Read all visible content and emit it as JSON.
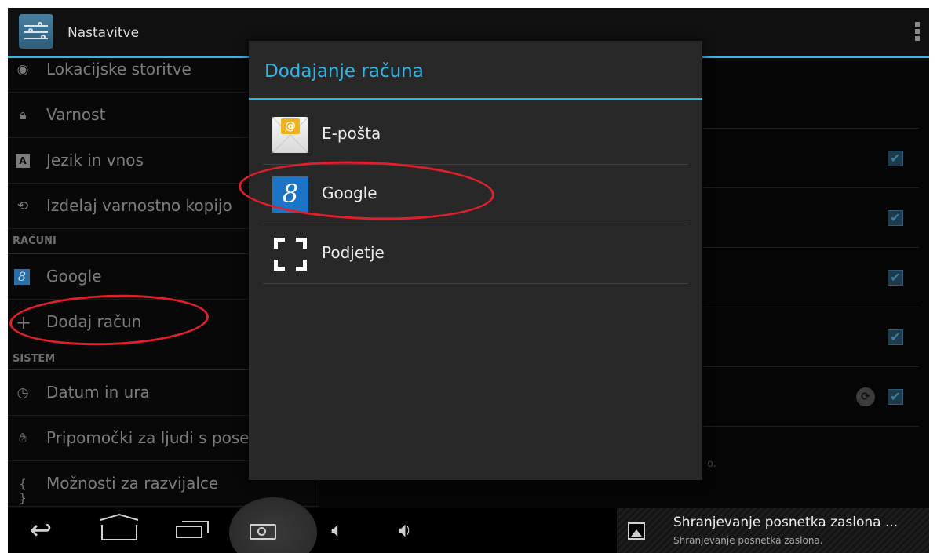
{
  "app": {
    "title": "Nastavitve",
    "settings_icon": "settings-sliders-icon",
    "menu_icon": "overflow-menu-icon"
  },
  "settings_list": {
    "items_top": [
      {
        "label": "Lokacijske storitve",
        "icon": "location-icon"
      },
      {
        "label": "Varnost",
        "icon": "lock-icon"
      },
      {
        "label": "Jezik in vnos",
        "icon": "keyboard-icon"
      },
      {
        "label": "Izdelaj varnostno kopijo",
        "icon": "backup-icon"
      }
    ],
    "header_accounts": "RAČUNI",
    "items_accounts": [
      {
        "label": "Google",
        "icon": "google-icon"
      },
      {
        "label": "Dodaj račun",
        "icon": "plus-icon"
      }
    ],
    "header_system": "SISTEM",
    "items_system": [
      {
        "label": "Datum in ura",
        "icon": "clock-icon"
      },
      {
        "label": "Pripomočki za ljudi s posebnimi potrebami",
        "icon": "hand-icon"
      },
      {
        "label": "Možnosti za razvijalce",
        "icon": "braces-icon"
      }
    ]
  },
  "right_panel": {
    "hint_fragment": "o."
  },
  "dialog": {
    "title": "Dodajanje računa",
    "options": [
      {
        "label": "E-pošta",
        "icon": "email-icon"
      },
      {
        "label": "Google",
        "icon": "google-icon"
      },
      {
        "label": "Podjetje",
        "icon": "exchange-icon"
      }
    ]
  },
  "navbar": {
    "buttons": [
      "back-icon",
      "home-icon",
      "recent-apps-icon",
      "screenshot-icon",
      "volume-down-icon",
      "volume-up-icon"
    ]
  },
  "notification": {
    "title": "Shranjevanje posnetka zaslona ...",
    "subtitle": "Shranjevanje posnetka zaslona.",
    "icon": "image-icon"
  },
  "colors": {
    "accent": "#33b5e5",
    "annotation": "#e01f2a"
  }
}
